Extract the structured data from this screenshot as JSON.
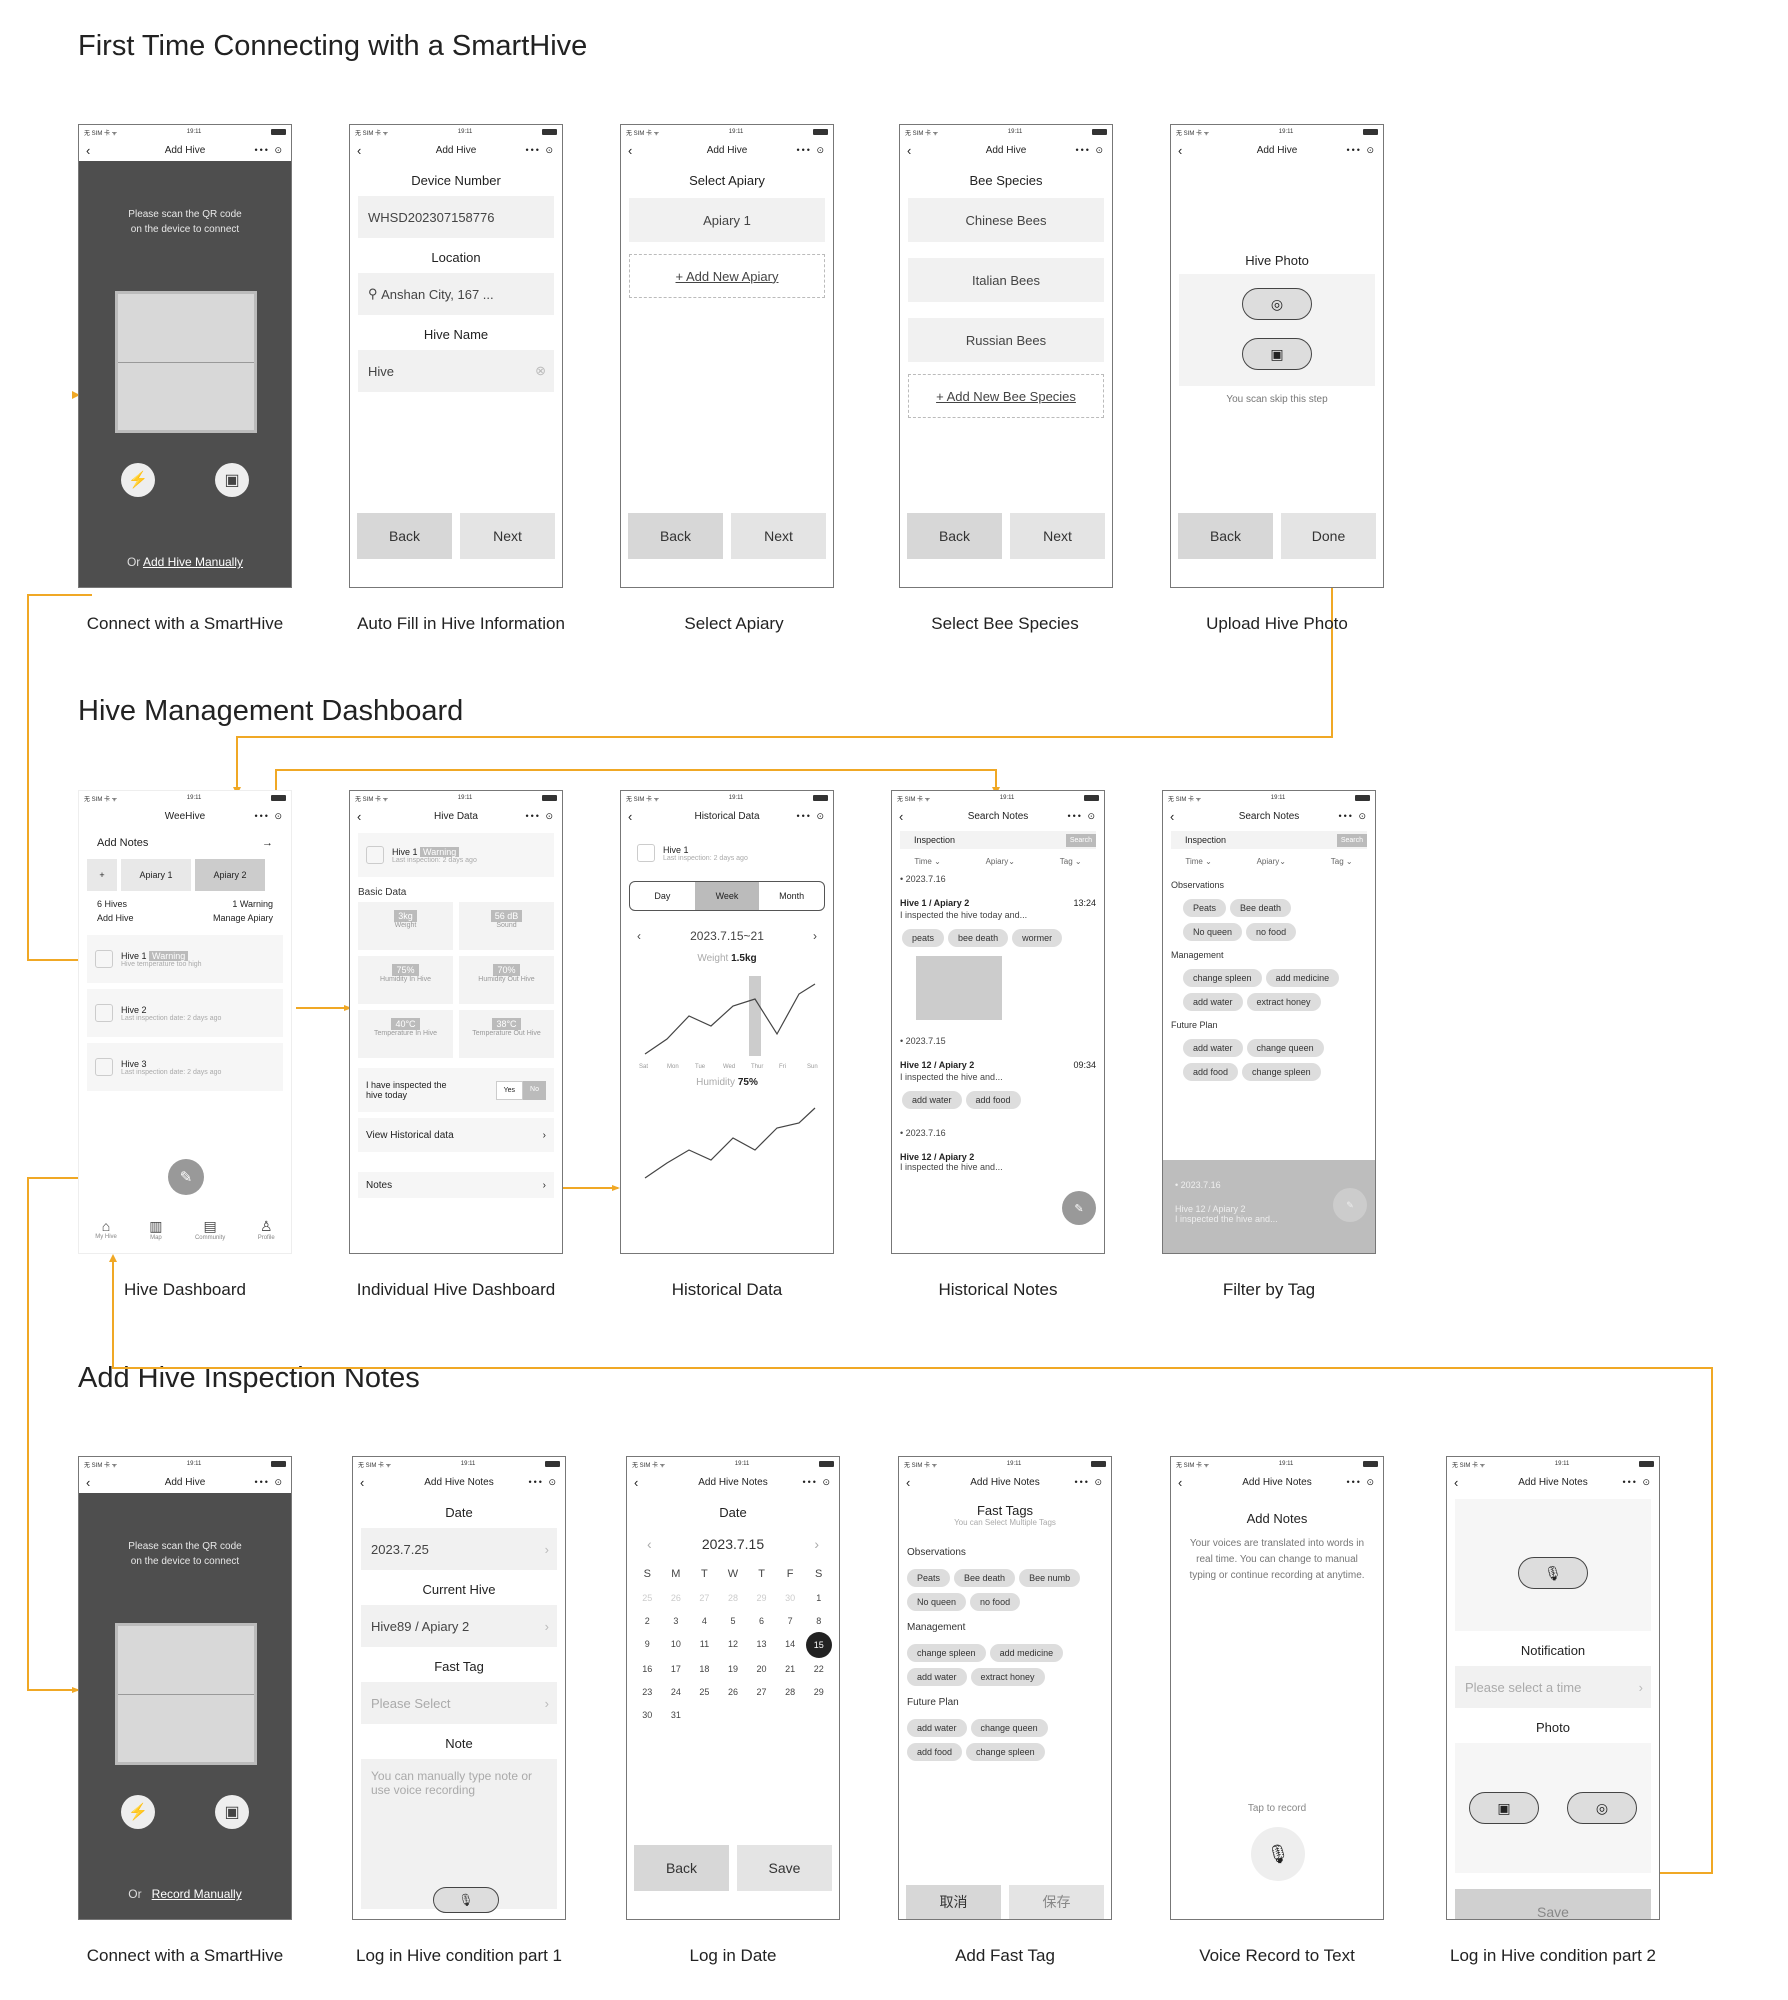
{
  "sections": {
    "s1": "First Time Connecting with a SmartHive",
    "s2": "Hive Management Dashboard",
    "s3": "Add Hive Inspection Notes"
  },
  "status": {
    "carrier": "无 SIM 卡 ᯤ",
    "time": "19:11"
  },
  "nav": {
    "add_hive": "Add Hive",
    "hive_data": "Hive Data",
    "historical": "Historical Data",
    "search_notes": "Search Notes",
    "weehive": "WeeHive",
    "add_notes": "Add Hive Notes",
    "caps": "••• ⊙",
    "back": "‹"
  },
  "captions": {
    "c1": "Connect with a SmartHive",
    "c2": "Auto Fill in Hive Information",
    "c3": "Select Apiary",
    "c4": "Select Bee Species",
    "c5": "Upload Hive Photo",
    "c6": "Hive Dashboard",
    "c7": "Individual Hive Dashboard",
    "c8": "Historical Data",
    "c9": "Historical Notes",
    "c10": "Filter by Tag",
    "c11": "Connect with a SmartHive",
    "c12": "Log in Hive condition part 1",
    "c13": "Log in Date",
    "c14": "Add Fast Tag",
    "c15": "Voice Record to Text",
    "c16": "Log in Hive condition part 2"
  },
  "scan": {
    "msg1": "Please scan the QR code",
    "msg2": "on the device to connect",
    "or": "Or",
    "link1": "Add Hive Manually",
    "link2": "Record Manually"
  },
  "autofill": {
    "device_label": "Device Number",
    "device": "WHSD202307158776",
    "loc_label": "Location",
    "loc": "Anshan City, 167 ...",
    "name_label": "Hive Name",
    "name": "Hive"
  },
  "buttons": {
    "back": "Back",
    "next": "Next",
    "done": "Done",
    "save": "Save",
    "cancel_cn": "取消",
    "save_cn": "保存"
  },
  "apiary": {
    "label": "Select Apiary",
    "a1": "Apiary 1",
    "add": "+ Add New Apiary"
  },
  "species": {
    "label": "Bee Species",
    "b1": "Chinese Bees",
    "b2": "Italian Bees",
    "b3": "Russian Bees",
    "add": "+ Add New Bee Species"
  },
  "photo": {
    "label": "Hive Photo",
    "skip": "You scan skip this step"
  },
  "dash": {
    "add_notes": "Add Notes",
    "tab_add": "+",
    "tab1": "Apiary 1",
    "tab2": "Apiary 2",
    "hives": "6 Hives",
    "warn": "1 Warning",
    "add_hive": "Add Hive",
    "manage": "Manage Apiary",
    "h1": "Hive 1",
    "h1b": "Warning",
    "h1s": "Hive temperature too high",
    "h2": "Hive 2",
    "h2s": "Last inspection date: 2 days ago",
    "h3": "Hive 3",
    "h3s": "Last inspection date: 2 days ago",
    "nav1": "My Hive",
    "nav2": "Map",
    "nav3": "Community",
    "nav4": "Profile"
  },
  "hive": {
    "title": "Hive 1",
    "badge": "Warning",
    "sub": "Last inspection: 2 days ago",
    "basic": "Basic Data",
    "m1v": "3kg",
    "m1l": "Weight",
    "m2v": "56 dB",
    "m2l": "Sound",
    "m3v": "75%",
    "m3l": "Humidity In Hive",
    "m4v": "70%",
    "m4l": "Humidity Out Hive",
    "m5v": "40°C",
    "m5l": "Temperature In Hive",
    "m6v": "38°C",
    "m6l": "Temperature Out Hive",
    "insp": "I have inspected the hive today",
    "yes": "Yes",
    "no": "No",
    "hist": "View Historical data",
    "notes": "Notes"
  },
  "hist": {
    "hive": "Hive 1",
    "sub": "Last inspection: 2 days ago",
    "day": "Day",
    "week": "Week",
    "month": "Month",
    "range": "2023.7.15~21",
    "w_label": "Weight",
    "w_val": "1.5kg",
    "h_label": "Humidity",
    "h_val": "75%",
    "days": [
      "Sat",
      "Mon",
      "Tue",
      "Wed",
      "Thur",
      "Fri",
      "Sun"
    ]
  },
  "notes": {
    "search": "Inspection",
    "search_btn": "Search",
    "f1": "Time ⌄",
    "f2": "Apiary⌄",
    "f3": "Tag ⌄",
    "d1": "• 2023.7.16",
    "n1t": "Hive 1 / Apiary 2",
    "n1time": "13:24",
    "n1": "I inspected the hive today and...",
    "t1": "peats",
    "t2": "bee death",
    "t3": "wormer",
    "d2": "• 2023.7.15",
    "n2t": "Hive 12 / Apiary 2",
    "n2time": "09:34",
    "n2": "I inspected the hive and...",
    "t4": "add water",
    "t5": "add food",
    "d3": "• 2023.7.16",
    "n3t": "Hive 12 / Apiary 2",
    "n3": "I inspected the hive and..."
  },
  "filter": {
    "obs": "Observations",
    "o1": "Peats",
    "o2": "Bee death",
    "o3": "No queen",
    "o4": "no food",
    "mgmt": "Management",
    "m1": "change spleen",
    "m2": "add medicine",
    "m3": "add water",
    "m4": "extract honey",
    "fp": "Future Plan",
    "p1": "add water",
    "p2": "change queen",
    "p3": "add food",
    "p4": "change spleen",
    "d": "• 2023.7.16",
    "t": "Hive 12 / Apiary 2",
    "n": "I inspected the hive and..."
  },
  "log1": {
    "date_label": "Date",
    "date": "2023.7.25",
    "hive_label": "Current Hive",
    "hive": "Hive89 / Apiary 2",
    "tag_label": "Fast Tag",
    "tag": "Please Select",
    "note_label": "Note",
    "note": "You can manually type note or use voice recording"
  },
  "cal": {
    "label": "Date",
    "month": "2023.7.15",
    "wd": [
      "S",
      "M",
      "T",
      "W",
      "T",
      "F",
      "S"
    ],
    "days": [
      "25",
      "26",
      "27",
      "28",
      "29",
      "30",
      "1",
      "2",
      "3",
      "4",
      "5",
      "6",
      "7",
      "8",
      "9",
      "10",
      "11",
      "12",
      "13",
      "14",
      "15",
      "16",
      "17",
      "18",
      "19",
      "20",
      "21",
      "22",
      "23",
      "24",
      "25",
      "26",
      "27",
      "28",
      "29",
      "30",
      "31"
    ]
  },
  "fast": {
    "title": "Fast Tags",
    "sub": "You can Select Multiple Tags",
    "obs": "Observations",
    "o1": "Peats",
    "o2": "Bee death",
    "o3": "Bee numb",
    "o4": "No queen",
    "o5": "no food",
    "mgmt": "Management",
    "m1": "change spleen",
    "m2": "add medicine",
    "m3": "add water",
    "m4": "extract honey",
    "fp": "Future Plan",
    "p1": "add water",
    "p2": "change queen",
    "p3": "add food",
    "p4": "change spleen"
  },
  "voice": {
    "title": "Add Notes",
    "desc": "Your voices are translated into words in real time. You can change to manual typing or continue recording at anytime.",
    "tap": "Tap to record"
  },
  "log2": {
    "notif": "Notification",
    "notif_ph": "Please select a time",
    "photo": "Photo",
    "save": "Save"
  },
  "colors": {
    "accent": "#f0a825",
    "dark": "#4e4e4e"
  }
}
